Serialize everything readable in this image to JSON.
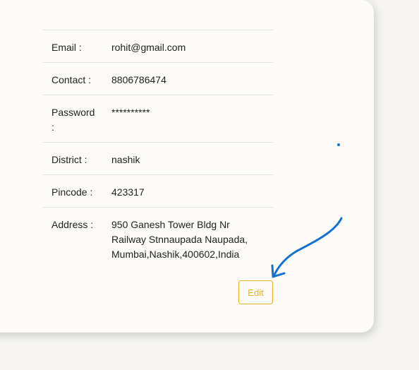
{
  "profile": {
    "rows": [
      {
        "label": "Email :",
        "value": "rohit@gmail.com"
      },
      {
        "label": "Contact :",
        "value": "8806786474"
      },
      {
        "label": "Password :",
        "value": "**********"
      },
      {
        "label": "District :",
        "value": "nashik"
      },
      {
        "label": "Pincode :",
        "value": "423317"
      },
      {
        "label": "Address :",
        "value": "950 Ganesh Tower Bldg Nr Railway Stnnaupada Naupada, Mumbai,Nashik,400602,India"
      }
    ],
    "edit_label": "Edit"
  },
  "annotation": {
    "color": "#1570d4"
  }
}
